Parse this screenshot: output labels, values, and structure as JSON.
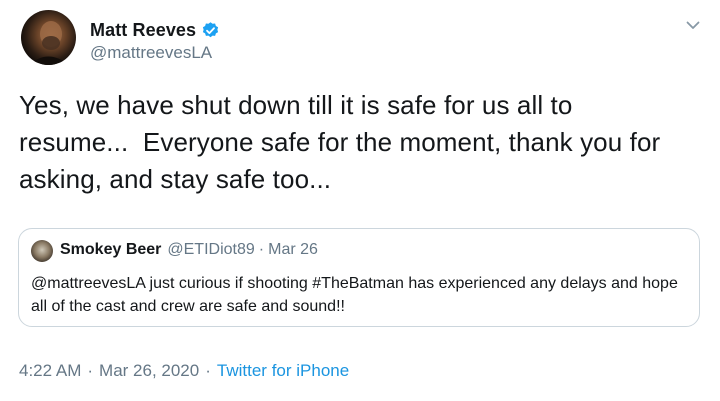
{
  "author": {
    "display_name": "Matt Reeves",
    "handle": "@mattreevesLA",
    "verified_icon": "verified-badge-icon",
    "verified_color": "#1da1f2"
  },
  "tweet": {
    "text": "Yes, we have shut down till it is safe for us all to\nresume...  Everyone safe for the moment, thank you for\nasking, and stay safe too...",
    "time": "4:22 AM",
    "separator": "·",
    "date": "Mar 26, 2020",
    "source": "Twitter for iPhone",
    "link_color": "#1b95e0",
    "menu_icon": "chevron-down-icon"
  },
  "quoted_tweet": {
    "display_name": "Smokey Beer",
    "handle": "@ETIDiot89",
    "separator": "·",
    "date": "Mar 26",
    "text": "@mattreevesLA just curious if shooting #TheBatman has experienced any delays and hope all of the cast and crew are safe and sound!!"
  }
}
